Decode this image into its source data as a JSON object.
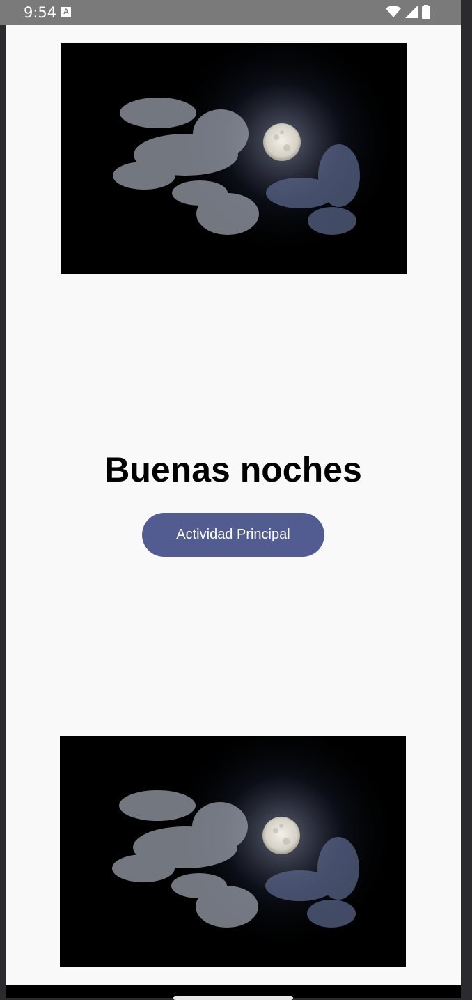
{
  "status_bar": {
    "time": "9:54",
    "notification_icon": "a-icon",
    "icons": [
      "wifi-icon",
      "cell-signal-icon",
      "battery-icon"
    ]
  },
  "images": [
    {
      "name": "moon-clouds-image-top",
      "description_icon": "moon-icon"
    },
    {
      "name": "moon-clouds-image-bottom",
      "description_icon": "moon-icon"
    }
  ],
  "main": {
    "title": "Buenas noches",
    "button_label": "Actividad Principal"
  },
  "colors": {
    "status_bar": "#7a7a7a",
    "background": "#f9f9f9",
    "button": "#525c90",
    "title": "#000000"
  }
}
